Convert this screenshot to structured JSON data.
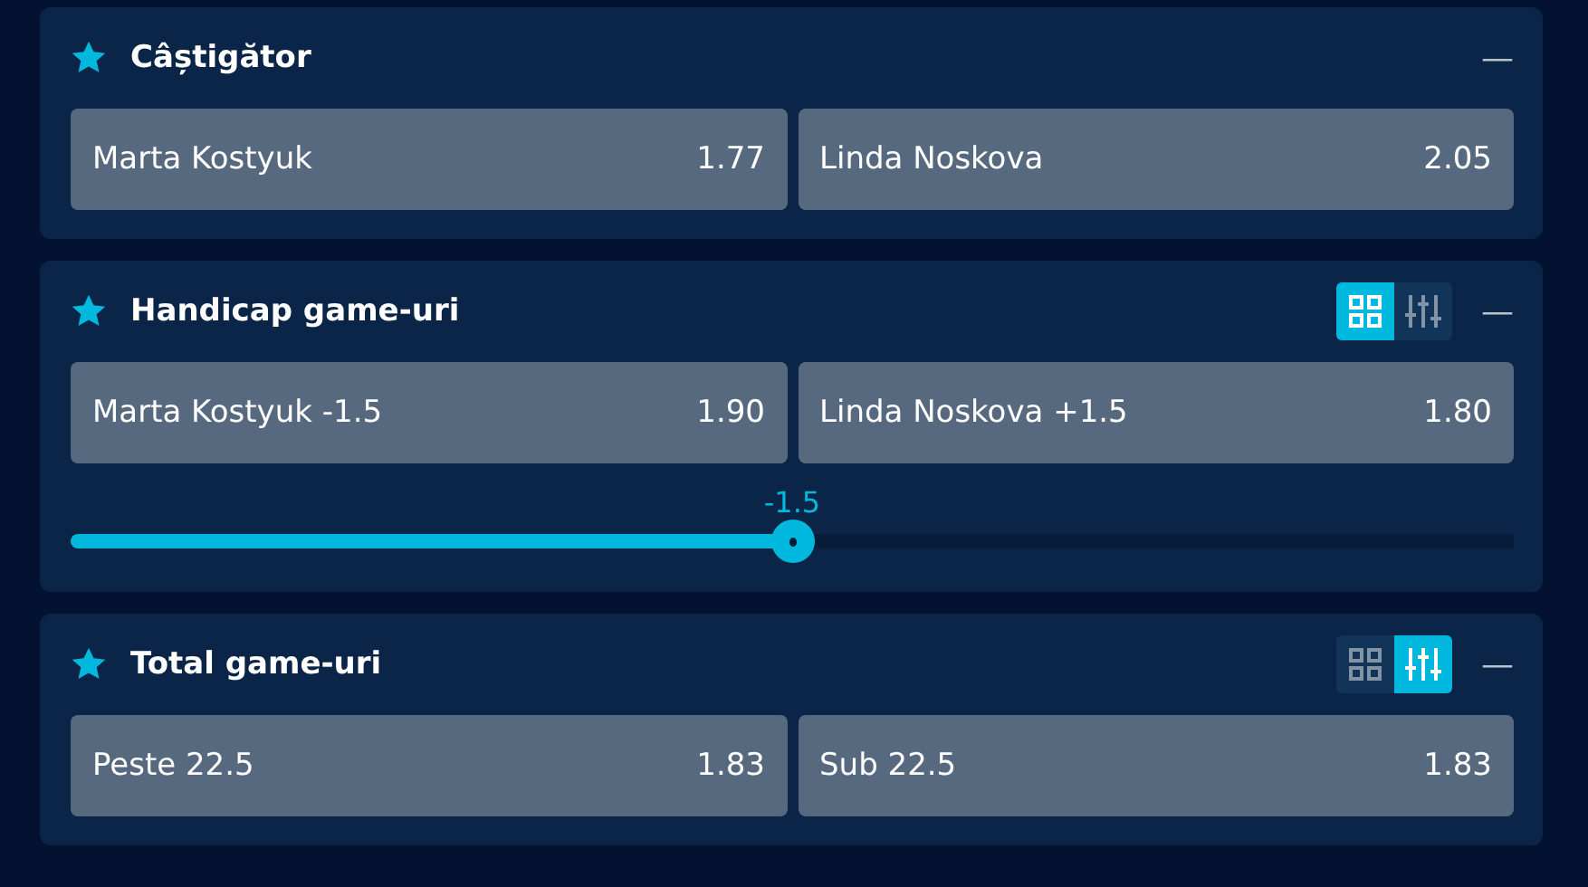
{
  "markets": [
    {
      "title": "Câștigător",
      "favorite": true,
      "collapse": "—",
      "outcomes": [
        {
          "name": "Marta Kostyuk",
          "odds": "1.77"
        },
        {
          "name": "Linda Noskova",
          "odds": "2.05"
        }
      ]
    },
    {
      "title": "Handicap game-uri",
      "favorite": true,
      "view_buttons": [
        {
          "kind": "grid",
          "selected": true
        },
        {
          "kind": "sliders",
          "selected": false
        }
      ],
      "collapse": "—",
      "outcomes": [
        {
          "name": "Marta Kostyuk -1.5",
          "odds": "1.90"
        },
        {
          "name": "Linda Noskova +1.5",
          "odds": "1.80"
        }
      ],
      "slider": {
        "reading": "-1.5",
        "level": 0.5
      }
    },
    {
      "title": "Total game-uri",
      "favorite": true,
      "view_buttons": [
        {
          "kind": "grid",
          "selected": false
        },
        {
          "kind": "sliders",
          "selected": true
        }
      ],
      "collapse": "—",
      "outcomes": [
        {
          "name": "Peste 22.5",
          "odds": "1.83"
        },
        {
          "name": "Sub 22.5",
          "odds": "1.83"
        }
      ]
    }
  ]
}
